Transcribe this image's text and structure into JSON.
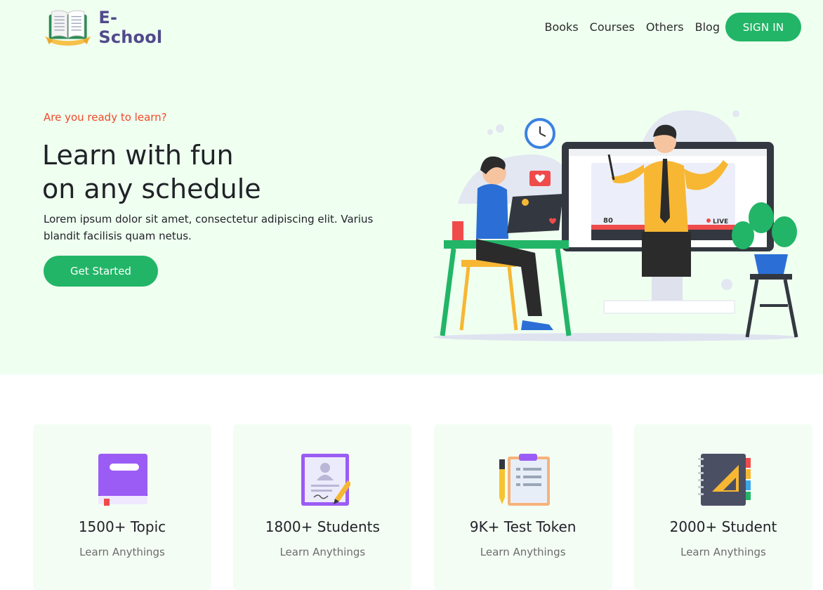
{
  "brand": {
    "name": "E- School"
  },
  "nav": {
    "links": [
      "Books",
      "Courses",
      "Others",
      "Blog"
    ],
    "signin_label": "SIGN IN"
  },
  "hero": {
    "eyebrow": "Are you ready to learn?",
    "headline_line1": "Learn with fun",
    "headline_line2": "on any schedule",
    "description": "Lorem ipsum dolor sit amet, consectetur adipiscing elit. Varius blandit facilisis quam netus.",
    "cta_label": "Get Started",
    "illustration": {
      "viewers": "80",
      "live_label": "LIVE"
    }
  },
  "features": [
    {
      "title": "1500+ Topic",
      "subtitle": "Learn Anythings",
      "icon": "book-icon"
    },
    {
      "title": "1800+ Students",
      "subtitle": "Learn Anythings",
      "icon": "certificate-icon"
    },
    {
      "title": "9K+ Test Token",
      "subtitle": "Learn Anythings",
      "icon": "clipboard-icon"
    },
    {
      "title": "2000+ Student",
      "subtitle": "Learn Anythings",
      "icon": "notebook-icon"
    }
  ],
  "colors": {
    "accent": "#22b567",
    "hero_bg": "#effff0",
    "eyebrow": "#ef4b27",
    "brand_text": "#514a8c"
  }
}
